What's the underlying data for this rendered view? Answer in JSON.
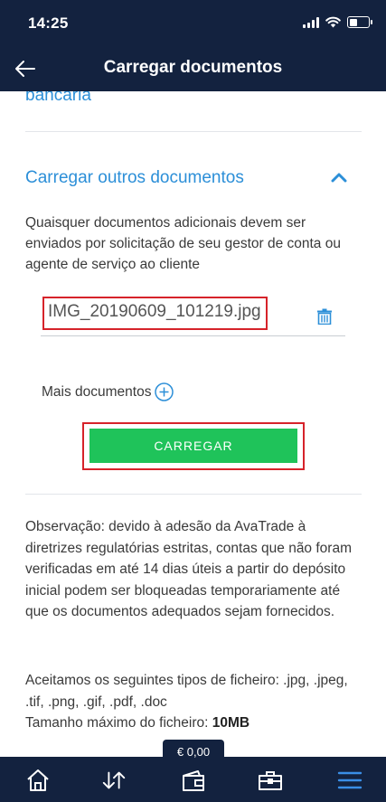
{
  "status_bar": {
    "time": "14:25"
  },
  "header": {
    "title": "Carregar documentos"
  },
  "previous_section": {
    "label": "bancária"
  },
  "accordion": {
    "title": "Carregar outros documentos",
    "description": "Quaisquer documentos adicionais devem ser enviados por solicitação de seu gestor de conta ou agente de serviço ao cliente",
    "file": {
      "name": "IMG_20190609_101219.jpg"
    },
    "more_documents_label": "Mais documentos",
    "upload_label": "CARREGAR"
  },
  "note": "Observação: devido à adesão da AvaTrade à diretrizes regulatórias estritas, contas que não foram verificadas em até 14 dias úteis a partir do depósito inicial podem ser bloqueadas temporariamente até que os documentos adequados sejam fornecidos.",
  "accepted_types": {
    "line1": "Aceitamos os seguintes tipos de ficheiro: .jpg, .jpeg, .tif, .png, .gif, .pdf, .doc",
    "max_size_label": "Tamanho máximo do ficheiro:",
    "max_size_value": "10MB"
  },
  "balance": "€ 0,00",
  "tabs": [
    {
      "icon": "home-icon"
    },
    {
      "icon": "transfer-arrows-icon"
    },
    {
      "icon": "wallet-icon"
    },
    {
      "icon": "briefcase-icon"
    },
    {
      "icon": "menu-icon",
      "active": true
    }
  ],
  "colors": {
    "navy": "#13223f",
    "link_blue": "#2c8fd8",
    "button_green": "#1fc35a",
    "highlight_red": "#d6232a",
    "active_tab_blue": "#3a8ee6"
  }
}
